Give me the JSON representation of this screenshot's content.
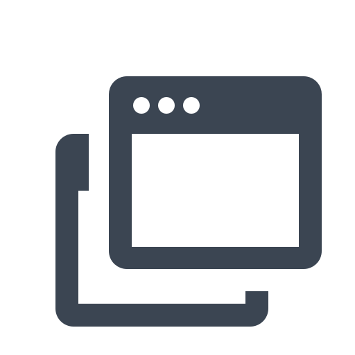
{
  "icon": {
    "name": "multiple-windows-icon",
    "color": "#3b4552",
    "background": "#ffffff",
    "dots": 3
  }
}
